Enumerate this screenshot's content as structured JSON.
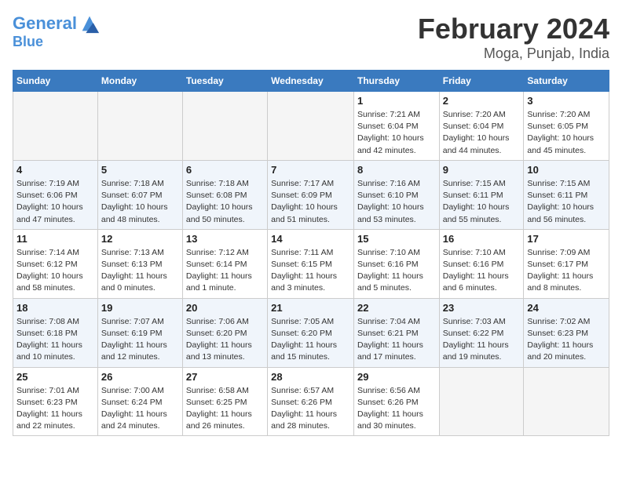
{
  "logo": {
    "line1": "General",
    "line2": "Blue"
  },
  "title": "February 2024",
  "subtitle": "Moga, Punjab, India",
  "weekdays": [
    "Sunday",
    "Monday",
    "Tuesday",
    "Wednesday",
    "Thursday",
    "Friday",
    "Saturday"
  ],
  "weeks": [
    [
      {
        "day": "",
        "info": ""
      },
      {
        "day": "",
        "info": ""
      },
      {
        "day": "",
        "info": ""
      },
      {
        "day": "",
        "info": ""
      },
      {
        "day": "1",
        "info": "Sunrise: 7:21 AM\nSunset: 6:04 PM\nDaylight: 10 hours\nand 42 minutes."
      },
      {
        "day": "2",
        "info": "Sunrise: 7:20 AM\nSunset: 6:04 PM\nDaylight: 10 hours\nand 44 minutes."
      },
      {
        "day": "3",
        "info": "Sunrise: 7:20 AM\nSunset: 6:05 PM\nDaylight: 10 hours\nand 45 minutes."
      }
    ],
    [
      {
        "day": "4",
        "info": "Sunrise: 7:19 AM\nSunset: 6:06 PM\nDaylight: 10 hours\nand 47 minutes."
      },
      {
        "day": "5",
        "info": "Sunrise: 7:18 AM\nSunset: 6:07 PM\nDaylight: 10 hours\nand 48 minutes."
      },
      {
        "day": "6",
        "info": "Sunrise: 7:18 AM\nSunset: 6:08 PM\nDaylight: 10 hours\nand 50 minutes."
      },
      {
        "day": "7",
        "info": "Sunrise: 7:17 AM\nSunset: 6:09 PM\nDaylight: 10 hours\nand 51 minutes."
      },
      {
        "day": "8",
        "info": "Sunrise: 7:16 AM\nSunset: 6:10 PM\nDaylight: 10 hours\nand 53 minutes."
      },
      {
        "day": "9",
        "info": "Sunrise: 7:15 AM\nSunset: 6:11 PM\nDaylight: 10 hours\nand 55 minutes."
      },
      {
        "day": "10",
        "info": "Sunrise: 7:15 AM\nSunset: 6:11 PM\nDaylight: 10 hours\nand 56 minutes."
      }
    ],
    [
      {
        "day": "11",
        "info": "Sunrise: 7:14 AM\nSunset: 6:12 PM\nDaylight: 10 hours\nand 58 minutes."
      },
      {
        "day": "12",
        "info": "Sunrise: 7:13 AM\nSunset: 6:13 PM\nDaylight: 11 hours\nand 0 minutes."
      },
      {
        "day": "13",
        "info": "Sunrise: 7:12 AM\nSunset: 6:14 PM\nDaylight: 11 hours\nand 1 minute."
      },
      {
        "day": "14",
        "info": "Sunrise: 7:11 AM\nSunset: 6:15 PM\nDaylight: 11 hours\nand 3 minutes."
      },
      {
        "day": "15",
        "info": "Sunrise: 7:10 AM\nSunset: 6:16 PM\nDaylight: 11 hours\nand 5 minutes."
      },
      {
        "day": "16",
        "info": "Sunrise: 7:10 AM\nSunset: 6:16 PM\nDaylight: 11 hours\nand 6 minutes."
      },
      {
        "day": "17",
        "info": "Sunrise: 7:09 AM\nSunset: 6:17 PM\nDaylight: 11 hours\nand 8 minutes."
      }
    ],
    [
      {
        "day": "18",
        "info": "Sunrise: 7:08 AM\nSunset: 6:18 PM\nDaylight: 11 hours\nand 10 minutes."
      },
      {
        "day": "19",
        "info": "Sunrise: 7:07 AM\nSunset: 6:19 PM\nDaylight: 11 hours\nand 12 minutes."
      },
      {
        "day": "20",
        "info": "Sunrise: 7:06 AM\nSunset: 6:20 PM\nDaylight: 11 hours\nand 13 minutes."
      },
      {
        "day": "21",
        "info": "Sunrise: 7:05 AM\nSunset: 6:20 PM\nDaylight: 11 hours\nand 15 minutes."
      },
      {
        "day": "22",
        "info": "Sunrise: 7:04 AM\nSunset: 6:21 PM\nDaylight: 11 hours\nand 17 minutes."
      },
      {
        "day": "23",
        "info": "Sunrise: 7:03 AM\nSunset: 6:22 PM\nDaylight: 11 hours\nand 19 minutes."
      },
      {
        "day": "24",
        "info": "Sunrise: 7:02 AM\nSunset: 6:23 PM\nDaylight: 11 hours\nand 20 minutes."
      }
    ],
    [
      {
        "day": "25",
        "info": "Sunrise: 7:01 AM\nSunset: 6:23 PM\nDaylight: 11 hours\nand 22 minutes."
      },
      {
        "day": "26",
        "info": "Sunrise: 7:00 AM\nSunset: 6:24 PM\nDaylight: 11 hours\nand 24 minutes."
      },
      {
        "day": "27",
        "info": "Sunrise: 6:58 AM\nSunset: 6:25 PM\nDaylight: 11 hours\nand 26 minutes."
      },
      {
        "day": "28",
        "info": "Sunrise: 6:57 AM\nSunset: 6:26 PM\nDaylight: 11 hours\nand 28 minutes."
      },
      {
        "day": "29",
        "info": "Sunrise: 6:56 AM\nSunset: 6:26 PM\nDaylight: 11 hours\nand 30 minutes."
      },
      {
        "day": "",
        "info": ""
      },
      {
        "day": "",
        "info": ""
      }
    ]
  ]
}
